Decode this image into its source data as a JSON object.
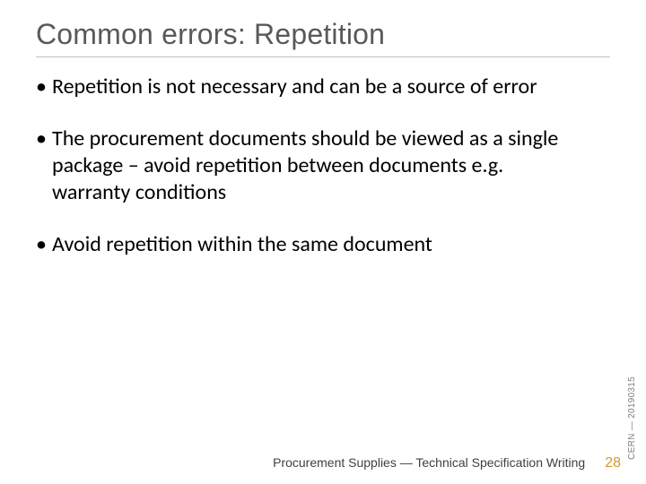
{
  "title": "Common errors: Repetition",
  "bullets": [
    "Repetition is not necessary and can be a source of error",
    "The procurement documents should be viewed as a single package – avoid repetition between documents e.g. warranty conditions",
    "Avoid repetition within the same document"
  ],
  "side_label": "CERN — 20190315",
  "footer": {
    "text": "Procurement Supplies — Technical Specification Writing",
    "page": "28"
  }
}
